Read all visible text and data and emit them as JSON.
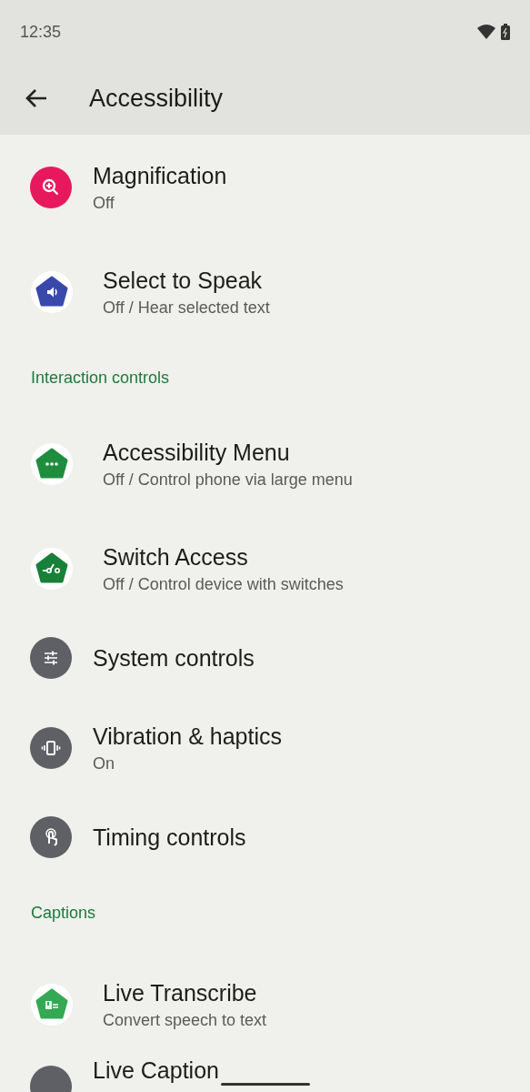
{
  "status_bar": {
    "time": "12:35"
  },
  "app_bar": {
    "title": "Accessibility"
  },
  "sections": [
    {
      "items": [
        {
          "kind": "setting",
          "title": "Magnification",
          "summary": "Off",
          "color": "#e8185e"
        },
        {
          "kind": "app",
          "title": "Select to Speak",
          "summary": "Off / Hear selected text",
          "color": "#3949ab"
        }
      ]
    },
    {
      "header": "Interaction controls",
      "items": [
        {
          "kind": "app",
          "title": "Accessibility Menu",
          "summary": "Off / Control phone via large menu",
          "color": "#1e8e3e"
        },
        {
          "kind": "app",
          "title": "Switch Access",
          "summary": "Off / Control device with switches",
          "color": "#188038"
        },
        {
          "kind": "setting",
          "title": "System controls",
          "color": "#5f6066"
        },
        {
          "kind": "setting",
          "title": "Vibration & haptics",
          "summary": "On",
          "color": "#5f6066"
        },
        {
          "kind": "setting",
          "title": "Timing controls",
          "color": "#5f6066"
        }
      ]
    },
    {
      "header": "Captions",
      "items": [
        {
          "kind": "app",
          "title": "Live Transcribe",
          "summary": "Convert speech to text",
          "color": "#34a853"
        },
        {
          "kind": "setting",
          "title": "Live Caption",
          "color": "#5f6066"
        }
      ]
    }
  ]
}
